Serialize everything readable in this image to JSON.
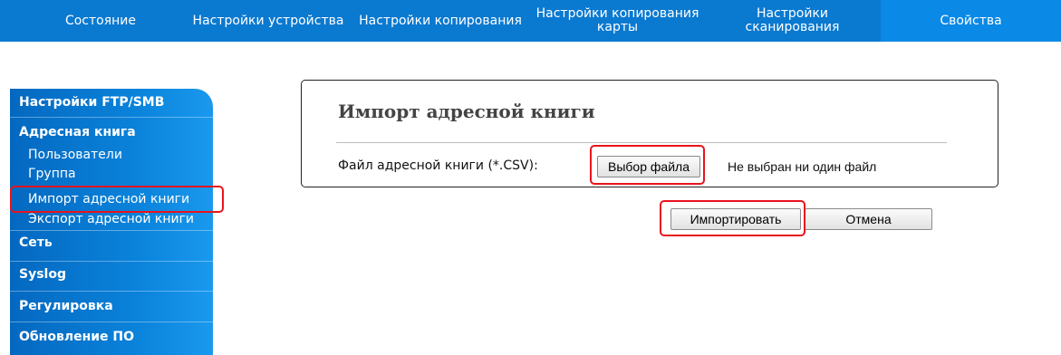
{
  "nav": {
    "tabs": [
      {
        "label": "Состояние"
      },
      {
        "label": "Настройки устройства"
      },
      {
        "label": "Настройки копирования"
      },
      {
        "label_line1": "Настройки копирования",
        "label_line2": "карты"
      },
      {
        "label_line1": "Настройки",
        "label_line2": "сканирования"
      },
      {
        "label": "Свойства"
      }
    ],
    "active_color": "#0a89e6",
    "bar_color": "#0a79d0"
  },
  "sidebar": {
    "sections": [
      {
        "label": "Настройки FTP/SMB"
      },
      {
        "label": "Адресная книга"
      },
      {
        "label": "Сеть"
      },
      {
        "label": "Syslog"
      },
      {
        "label": "Регулировка"
      },
      {
        "label": "Обновление ПО"
      }
    ],
    "address_book_items": [
      {
        "label": "Пользователи"
      },
      {
        "label": "Группа"
      },
      {
        "label": "Импорт адресной книги"
      },
      {
        "label": "Экспорт адресной книги"
      }
    ]
  },
  "panel": {
    "title": "Импорт адресной книги",
    "file_label": "Файл адресной книги (*.CSV):",
    "choose_button": "Выбор файла",
    "file_status": "Не выбран ни один файл"
  },
  "actions": {
    "import_button": "Импортировать",
    "cancel_button": "Отмена"
  },
  "highlight_color": "#e8141c"
}
